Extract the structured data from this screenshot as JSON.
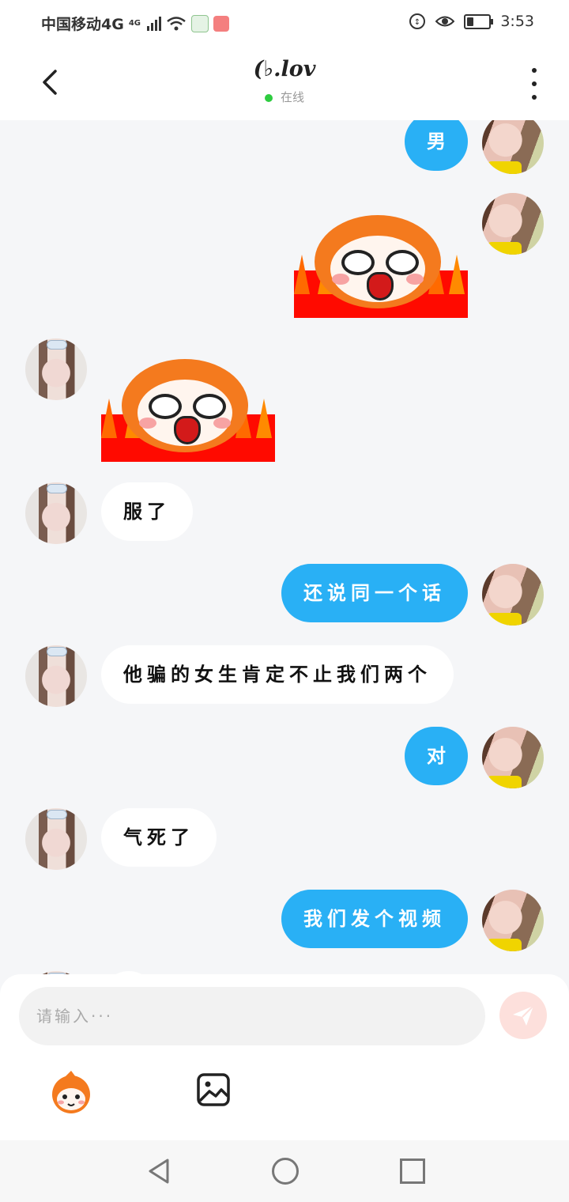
{
  "status_bar": {
    "carrier": "中国移动4G",
    "network_superscript": "4G",
    "time": "3:53",
    "battery_level": 0.3
  },
  "header": {
    "title": "(♭.lov",
    "status": "在线"
  },
  "messages": [
    {
      "side": "me",
      "type": "text",
      "text": "男"
    },
    {
      "side": "me",
      "type": "sticker",
      "sticker": "angry-chibi-fire"
    },
    {
      "side": "other",
      "type": "sticker",
      "sticker": "angry-chibi-fire"
    },
    {
      "side": "other",
      "type": "text",
      "text": "服了"
    },
    {
      "side": "me",
      "type": "text",
      "text": "还说同一个话"
    },
    {
      "side": "other",
      "type": "text",
      "text": "他骗的女生肯定不止我们两个"
    },
    {
      "side": "me",
      "type": "text",
      "text": "对"
    },
    {
      "side": "other",
      "type": "text",
      "text": "气死了"
    },
    {
      "side": "me",
      "type": "text",
      "text": "我们发个视频"
    }
  ],
  "input": {
    "placeholder": "请输入···",
    "value": ""
  },
  "icons": {
    "back": "chevron-left-icon",
    "more": "more-vertical-icon",
    "send": "paper-plane-icon",
    "emoji": "chibi-emoji-icon",
    "image": "image-icon"
  },
  "colors": {
    "my_bubble": "#29b0f5",
    "other_bubble": "#ffffff",
    "online_dot": "#2ecc40",
    "background": "#f5f6f8"
  }
}
